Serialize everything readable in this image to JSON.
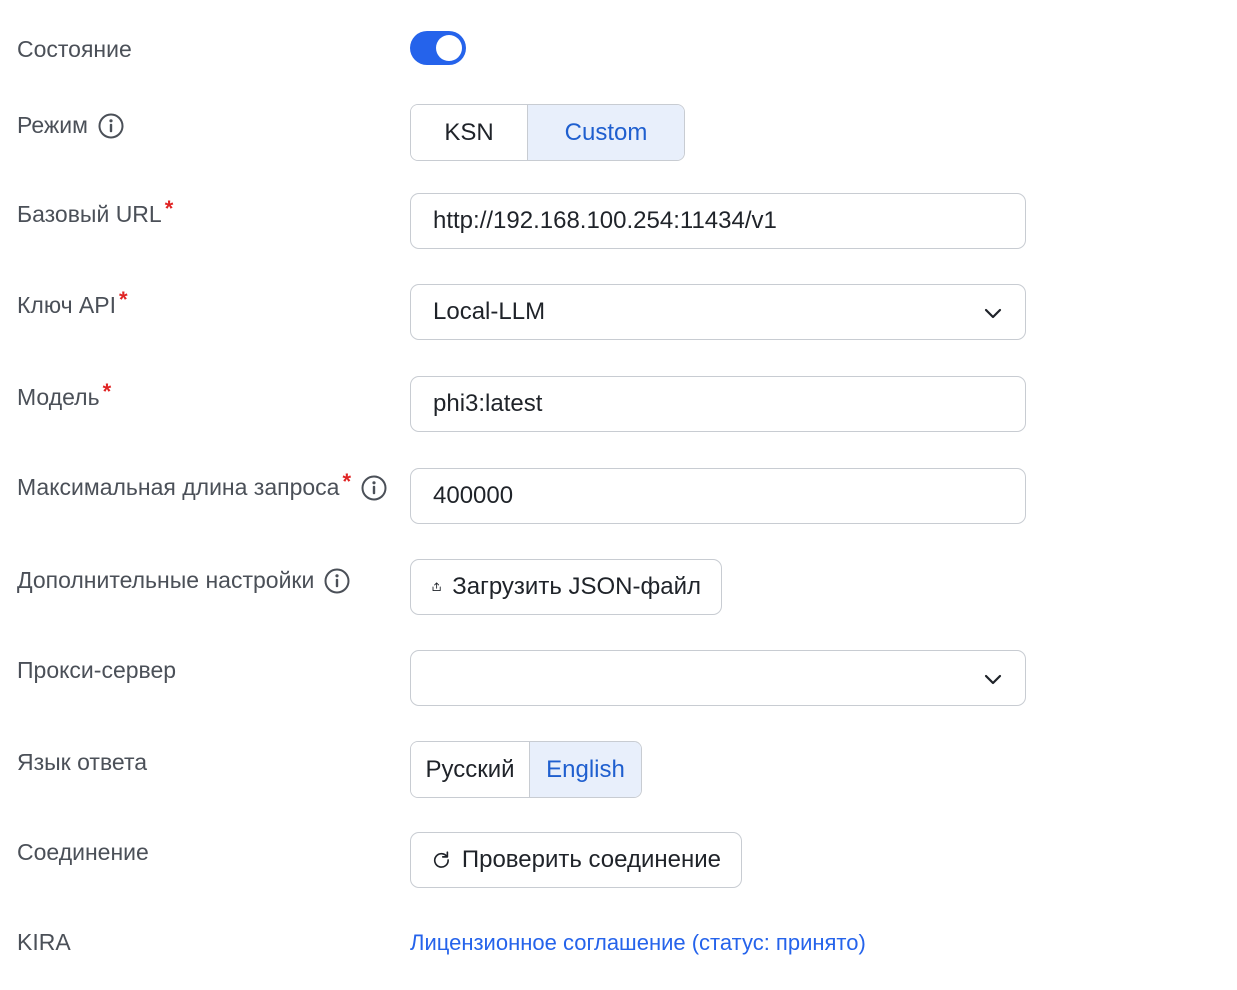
{
  "rows": {
    "state": {
      "label": "Состояние",
      "enabled": true
    },
    "mode": {
      "label": "Режим",
      "options": [
        "KSN",
        "Custom"
      ],
      "selected": "Custom"
    },
    "base_url": {
      "label": "Базовый URL",
      "required": "*",
      "value": "http://192.168.100.254:11434/v1"
    },
    "api_key": {
      "label": "Ключ API",
      "required": "*",
      "value": "Local-LLM"
    },
    "model": {
      "label": "Модель",
      "required": "*",
      "value": "phi3:latest"
    },
    "max_length": {
      "label": "Максимальная длина запроса",
      "required": "*",
      "value": "400000"
    },
    "extra_settings": {
      "label": "Дополнительные настройки",
      "button_label": "Загрузить JSON-файл"
    },
    "proxy": {
      "label": "Прокси-сервер",
      "value": ""
    },
    "response_language": {
      "label": "Язык ответа",
      "options": [
        "Русский",
        "English"
      ],
      "selected": "English"
    },
    "connection": {
      "label": "Соединение",
      "button_label": "Проверить соединение"
    },
    "kira": {
      "label": "KIRA",
      "link_text": "Лицензионное соглашение (статус: принято)"
    }
  },
  "colors": {
    "accent": "#2563eb",
    "required": "#e02424",
    "segment_active_bg": "#e8effb"
  },
  "icons": {
    "info": "info-icon",
    "chevron": "chevron-down-icon",
    "upload": "upload-icon",
    "refresh": "refresh-icon"
  }
}
